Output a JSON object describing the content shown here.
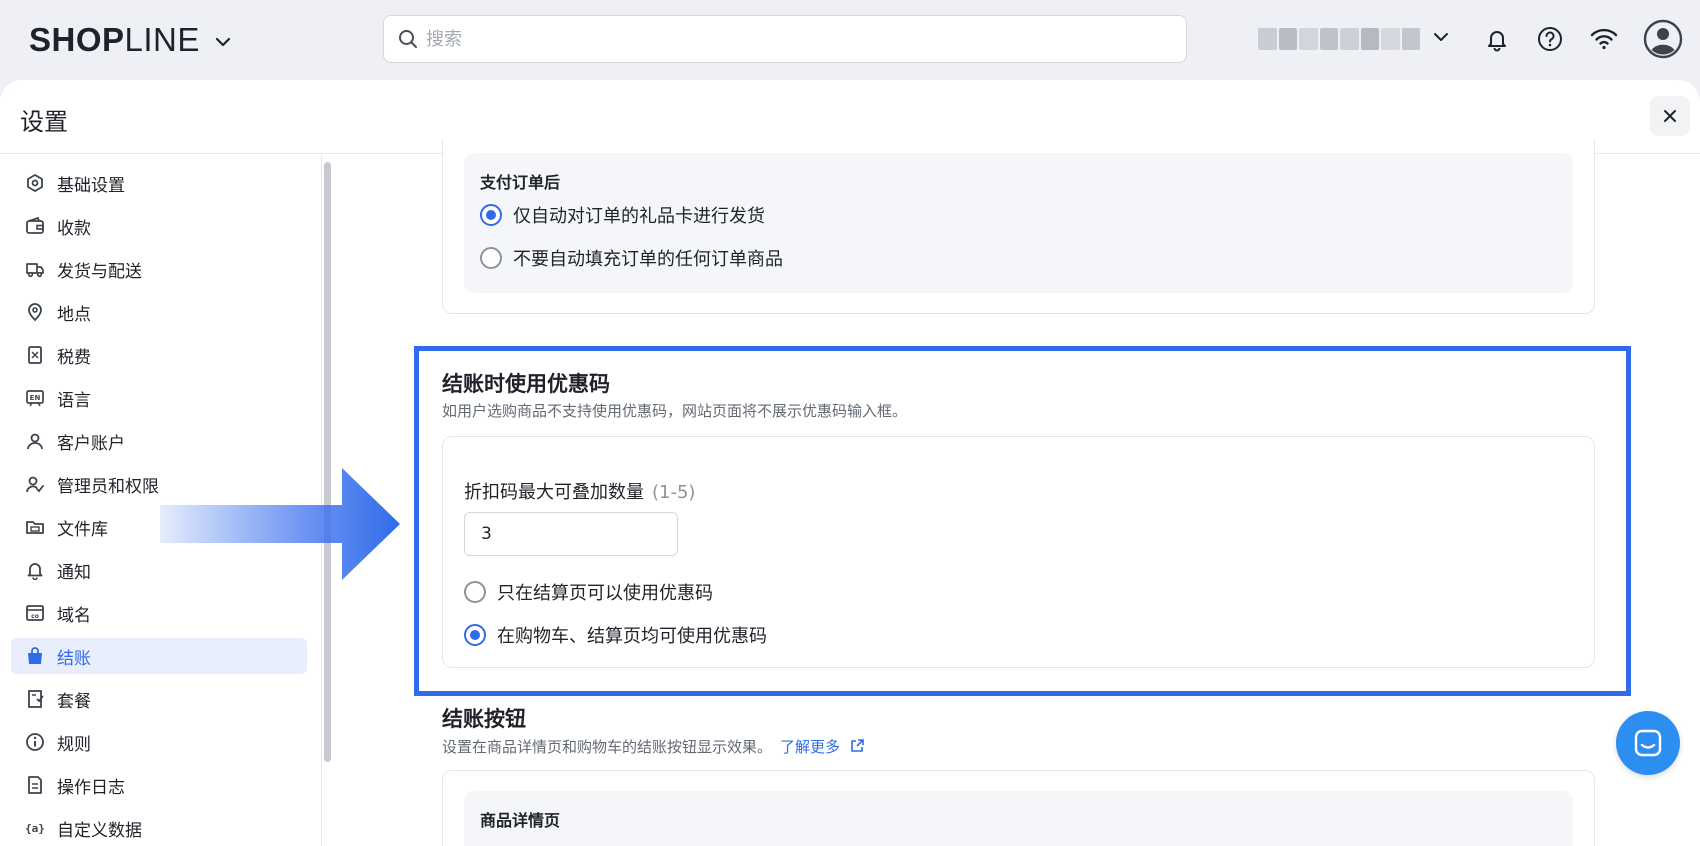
{
  "app": {
    "logo_text_bold": "SHOP",
    "logo_text_light": "LINE",
    "search_placeholder": "搜索"
  },
  "panel": {
    "title": "设置"
  },
  "sidebar": {
    "items": [
      {
        "label": "基础设置",
        "icon": "settings-hex-icon"
      },
      {
        "label": "收款",
        "icon": "wallet-icon"
      },
      {
        "label": "发货与配送",
        "icon": "truck-icon"
      },
      {
        "label": "地点",
        "icon": "location-pin-icon"
      },
      {
        "label": "税费",
        "icon": "tax-receipt-icon"
      },
      {
        "label": "语言",
        "icon": "language-icon"
      },
      {
        "label": "客户账户",
        "icon": "user-icon"
      },
      {
        "label": "管理员和权限",
        "icon": "user-permission-icon"
      },
      {
        "label": "文件库",
        "icon": "folder-icon"
      },
      {
        "label": "通知",
        "icon": "bell-icon"
      },
      {
        "label": "域名",
        "icon": "domain-icon"
      },
      {
        "label": "结账",
        "icon": "shopping-bag-icon",
        "active": true
      },
      {
        "label": "套餐",
        "icon": "plan-icon"
      },
      {
        "label": "规则",
        "icon": "info-icon"
      },
      {
        "label": "操作日志",
        "icon": "log-icon"
      },
      {
        "label": "自定义数据",
        "icon": "custom-data-icon"
      }
    ]
  },
  "fulfillment": {
    "subtitle": "支付订单后",
    "options": [
      {
        "label": "仅自动对订单的礼品卡进行发货",
        "checked": true
      },
      {
        "label": "不要自动填充订单的任何订单商品",
        "checked": false
      }
    ]
  },
  "discount": {
    "title": "结账时使用优惠码",
    "desc": "如用户选购商品不支持使用优惠码，网站页面将不展示优惠码输入框。",
    "field_label": "折扣码最大可叠加数量",
    "field_hint": "(1-5)",
    "field_value": "3",
    "options": [
      {
        "label": "只在结算页可以使用优惠码",
        "checked": false
      },
      {
        "label": "在购物车、结算页均可使用优惠码",
        "checked": true
      }
    ]
  },
  "checkout_button": {
    "title": "结账按钮",
    "desc": "设置在商品详情页和购物车的结账按钮显示效果。",
    "link": "了解更多",
    "sub_title": "商品详情页"
  },
  "colors": {
    "accent": "#2f6bea",
    "highlight_border": "#2f6bea",
    "chat": "#2b8ef0"
  }
}
